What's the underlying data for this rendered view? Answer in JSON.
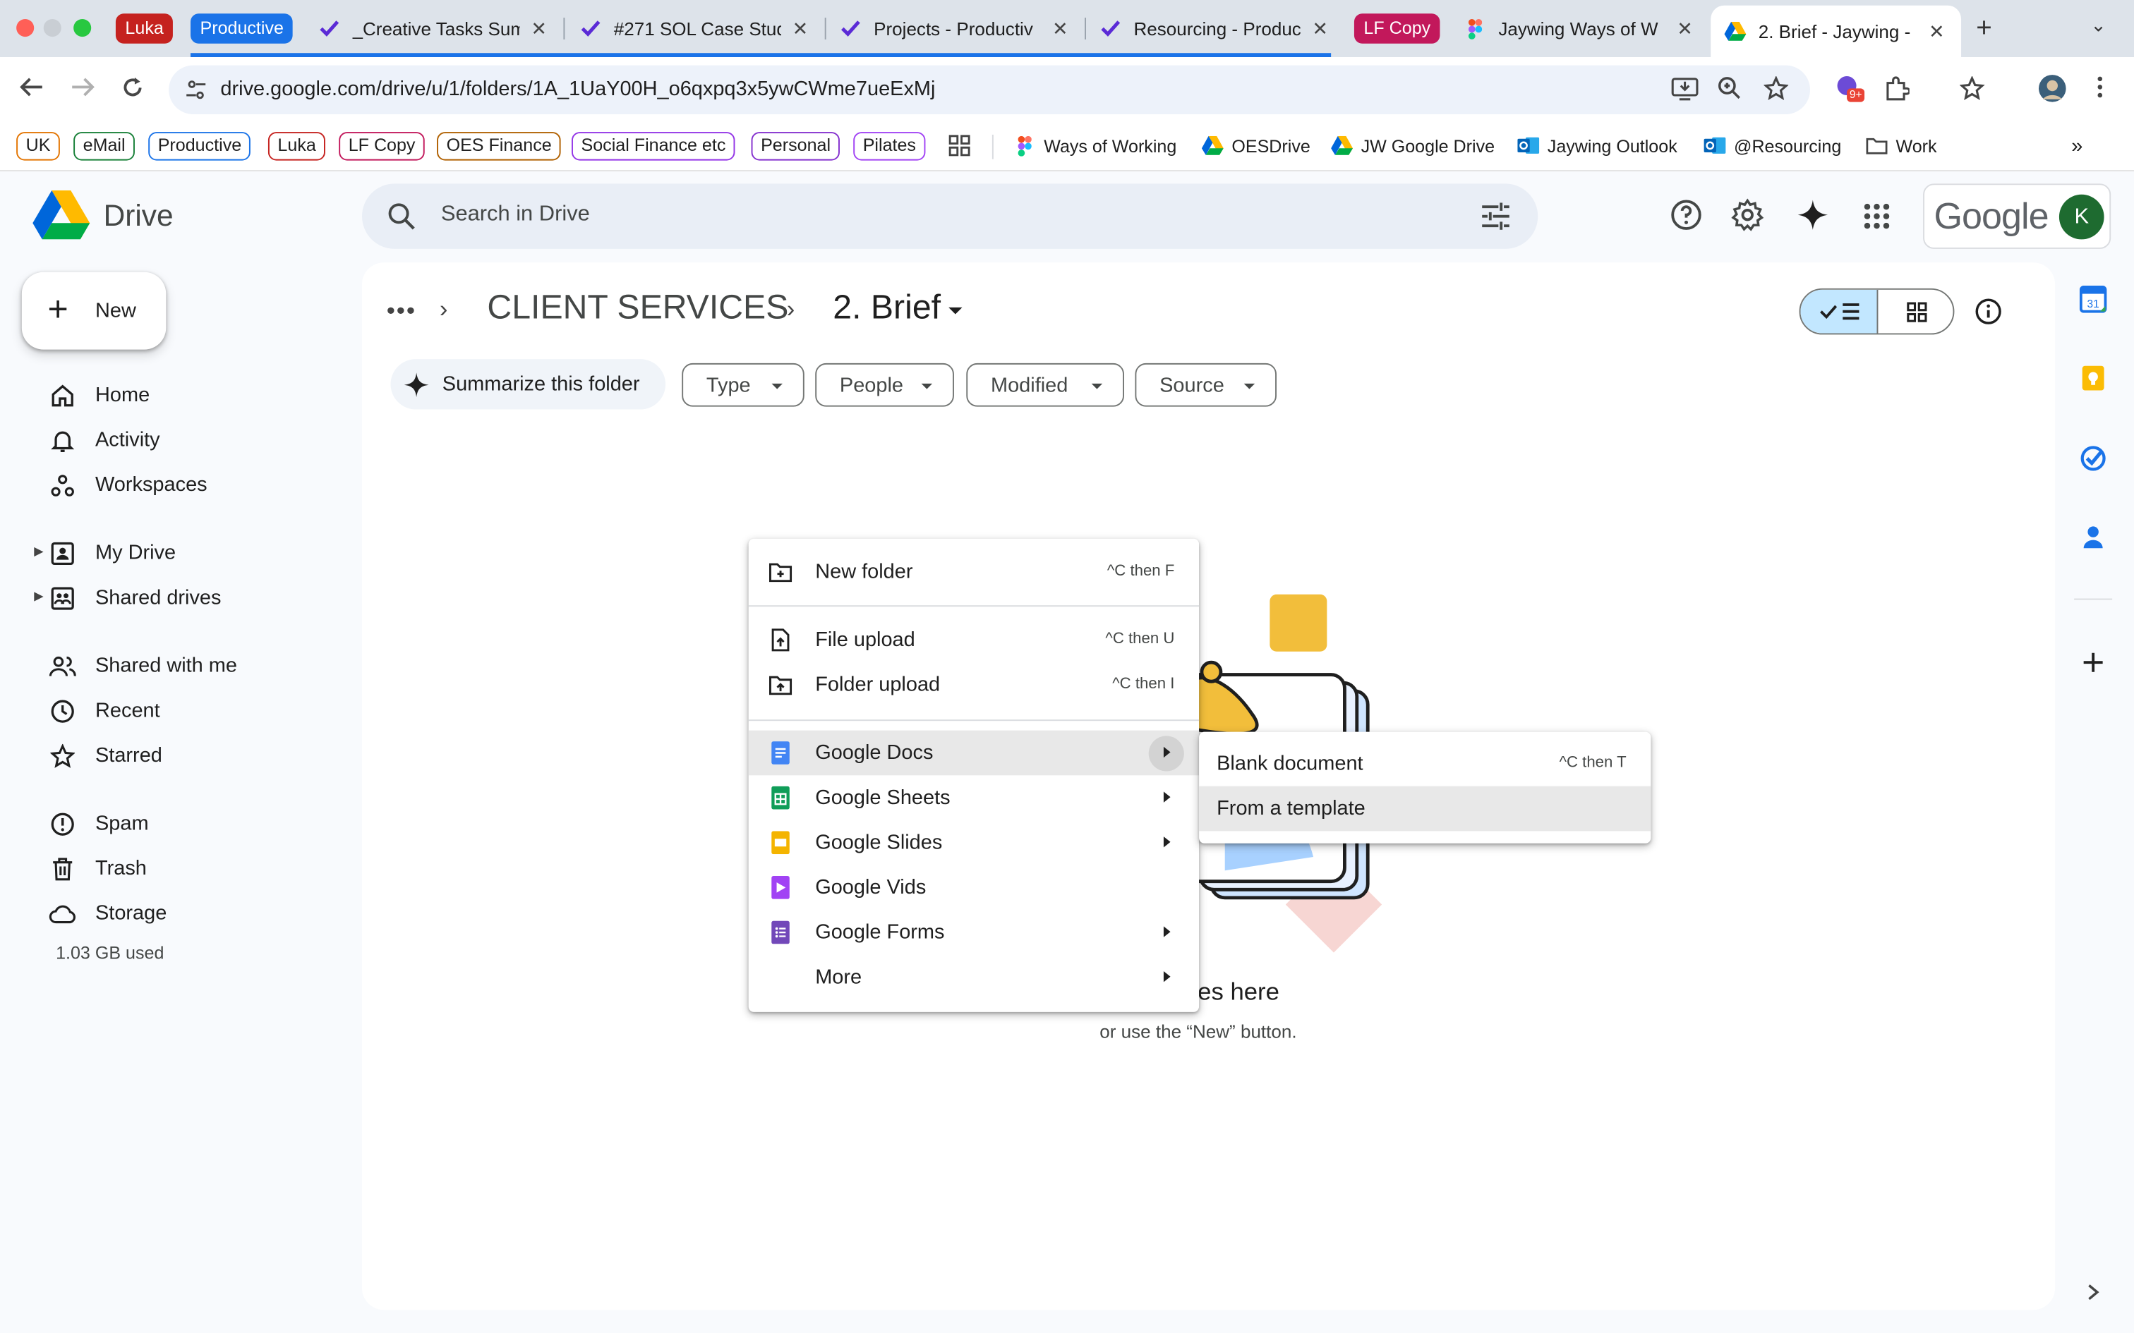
{
  "browser": {
    "tab_groups": [
      {
        "label": "Luka",
        "color": "#c5221f"
      },
      {
        "label": "Productive",
        "color": "#1a73e8"
      },
      {
        "label": "LF Copy",
        "color": "#c2185b"
      }
    ],
    "tabs": [
      {
        "title": "_Creative Tasks Sum",
        "favicon": "productive-icon"
      },
      {
        "title": "#271 SOL Case Stud",
        "favicon": "productive-icon"
      },
      {
        "title": "Projects - Productiv",
        "favicon": "productive-icon"
      },
      {
        "title": "Resourcing - Produc",
        "favicon": "productive-icon"
      },
      {
        "title": "Jaywing Ways of W",
        "favicon": "figma-icon"
      },
      {
        "title": "2. Brief - Jaywing -",
        "favicon": "drive-icon",
        "active": true
      }
    ],
    "new_tab": "+",
    "url": "drive.google.com/drive/u/1/folders/1A_1UaY00H_o6qxpq3x5ywCWme7ueExMj",
    "extension_badge": "9+",
    "bookmark_chips": [
      {
        "label": "UK",
        "color": "#e37400"
      },
      {
        "label": "eMail",
        "color": "#188038"
      },
      {
        "label": "Productive",
        "color": "#1a73e8"
      },
      {
        "label": "Luka",
        "color": "#c5221f"
      },
      {
        "label": "LF Copy",
        "color": "#c2185b"
      },
      {
        "label": "OES Finance",
        "color": "#b06000"
      },
      {
        "label": "Social Finance etc",
        "color": "#9334e6"
      },
      {
        "label": "Personal",
        "color": "#8430ce"
      },
      {
        "label": "Pilates",
        "color": "#a142f4"
      }
    ],
    "bookmarks": [
      {
        "label": "Ways of Working",
        "icon": "figma-icon"
      },
      {
        "label": "OESDrive",
        "icon": "drive-icon"
      },
      {
        "label": "JW Google Drive",
        "icon": "drive-icon"
      },
      {
        "label": "Jaywing Outlook",
        "icon": "outlook-icon"
      },
      {
        "label": "@Resourcing",
        "icon": "outlook-icon"
      },
      {
        "label": "Work",
        "icon": "folder-icon"
      }
    ]
  },
  "drive": {
    "app_name": "Drive",
    "search_placeholder": "Search in Drive",
    "google_label": "Google",
    "avatar_initial": "K",
    "new_label": "New",
    "nav": [
      {
        "label": "Home",
        "icon": "home-icon"
      },
      {
        "label": "Activity",
        "icon": "bell-icon"
      },
      {
        "label": "Workspaces",
        "icon": "workspaces-icon"
      },
      {
        "label": "My Drive",
        "icon": "my-drive-icon"
      },
      {
        "label": "Shared drives",
        "icon": "shared-drives-icon"
      },
      {
        "label": "Shared with me",
        "icon": "people-icon"
      },
      {
        "label": "Recent",
        "icon": "clock-icon"
      },
      {
        "label": "Starred",
        "icon": "star-icon"
      },
      {
        "label": "Spam",
        "icon": "spam-icon"
      },
      {
        "label": "Trash",
        "icon": "trash-icon"
      },
      {
        "label": "Storage",
        "icon": "cloud-icon"
      }
    ],
    "storage_used": "1.03 GB used",
    "breadcrumb": {
      "more": "•••",
      "parent": "CLIENT SERVICES",
      "current": "2. Brief"
    },
    "summarize_label": "Summarize this folder",
    "filters": [
      "Type",
      "People",
      "Modified",
      "Source"
    ],
    "empty_title_partial": "les here",
    "empty_subtitle": "or use the “New” button."
  },
  "menu": {
    "items": [
      {
        "label": "New folder",
        "shortcut": "^C then F",
        "icon": "new-folder-icon"
      },
      {
        "label": "File upload",
        "shortcut": "^C then U",
        "icon": "file-upload-icon"
      },
      {
        "label": "Folder upload",
        "shortcut": "^C then I",
        "icon": "folder-upload-icon"
      },
      {
        "label": "Google Docs",
        "icon": "docs-icon"
      },
      {
        "label": "Google Sheets",
        "icon": "sheets-icon"
      },
      {
        "label": "Google Slides",
        "icon": "slides-icon"
      },
      {
        "label": "Google Vids",
        "icon": "vids-icon"
      },
      {
        "label": "Google Forms",
        "icon": "forms-icon"
      },
      {
        "label": "More"
      }
    ],
    "submenu": [
      {
        "label": "Blank document",
        "shortcut": "^C then T"
      },
      {
        "label": "From a template"
      }
    ]
  }
}
